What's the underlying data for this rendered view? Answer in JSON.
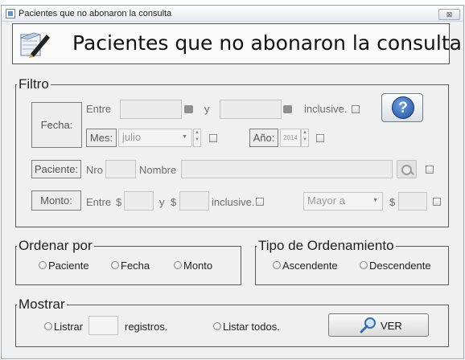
{
  "window": {
    "title": "Pacientes que no abonaron la consulta",
    "close_glyph": "⊠"
  },
  "header": {
    "title": "Pacientes que no abonaron la consulta",
    "logo_icon": "notebook-pen-icon"
  },
  "filtro": {
    "legend": "Filtro",
    "fecha": {
      "label": "Fecha:",
      "entre": "Entre",
      "y": "y",
      "inclusive": "inclusive.",
      "desde_value": "",
      "hasta_value": ""
    },
    "mes": {
      "label": "Mes:",
      "selected": "julio"
    },
    "anio": {
      "label": "Año:",
      "value": "2014"
    },
    "paciente": {
      "label": "Paciente:",
      "nro_label": "Nro",
      "nombre_label": "Nombre",
      "nro_value": "",
      "nombre_value": ""
    },
    "monto": {
      "label": "Monto:",
      "entre": "Entre",
      "currency1": "$",
      "y": "y",
      "currency2": "$",
      "inclusive": "inclusive.",
      "comparador_selected": "Mayor a",
      "currency3": "$",
      "desde_value": "",
      "hasta_value": "",
      "valor_value": ""
    },
    "help_label": "?"
  },
  "ordenar": {
    "legend": "Ordenar por",
    "options": [
      "Paciente",
      "Fecha",
      "Monto"
    ]
  },
  "tipo_orden": {
    "legend": "Tipo de Ordenamiento",
    "options": [
      "Ascendente",
      "Descendente"
    ]
  },
  "mostrar": {
    "legend": "Mostrar",
    "listrar": "Listrar",
    "registros": "registros.",
    "listar_todos": "Listar todos.",
    "registros_value": "",
    "ver_label": "VER"
  }
}
